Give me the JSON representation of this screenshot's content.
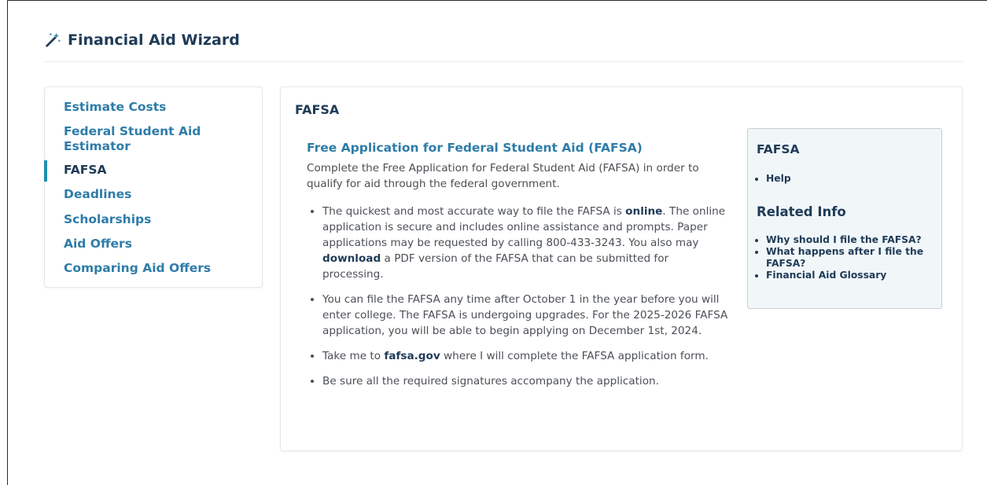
{
  "header": {
    "title": "Financial Aid Wizard",
    "icon": "magic-wand-icon"
  },
  "sidebar": {
    "items": [
      {
        "label": "Estimate Costs"
      },
      {
        "label": "Federal Student Aid Estimator"
      },
      {
        "label": "FAFSA"
      },
      {
        "label": "Deadlines"
      },
      {
        "label": "Scholarships"
      },
      {
        "label": "Aid Offers"
      },
      {
        "label": "Comparing Aid Offers"
      }
    ],
    "active": "FAFSA"
  },
  "main": {
    "heading": "FAFSA",
    "title": "Free Application for Federal Student Aid (FAFSA)",
    "intro": "Complete the Free Application for Federal Student Aid (FAFSA) in order to qualify for aid through the federal government.",
    "bullets": [
      {
        "pre": "The quickest and most accurate way to file the FAFSA is ",
        "link": "online",
        "mid": ". The online application is secure and includes online assistance and prompts. Paper applications may be requested by calling 800-433-3243. You also may ",
        "link2": "download",
        "post": " a PDF version of the FAFSA that can be submitted for processing."
      },
      {
        "text": "You can file the FAFSA any time after October 1 in the year before you will enter college. The FAFSA is undergoing upgrades. For the 2025-2026 FAFSA application, you will be able to begin applying on December 1st, 2024."
      },
      {
        "pre": "Take me to ",
        "link": "fafsa.gov",
        "post": " where I will complete the FAFSA application form."
      },
      {
        "text": "Be sure all the required signatures accompany the application."
      }
    ]
  },
  "panel": {
    "heading": "FAFSA",
    "links": [
      "Help"
    ],
    "related_heading": "Related Info",
    "related": [
      "Why should I file the FAFSA?",
      "What happens after I file the FAFSA?",
      "Financial Aid Glossary"
    ]
  },
  "colors": {
    "accent": "#2e7ca8",
    "heading": "#1f3b57",
    "active_bar": "#1f8fb3",
    "panel_bg": "#f1f6f9"
  }
}
